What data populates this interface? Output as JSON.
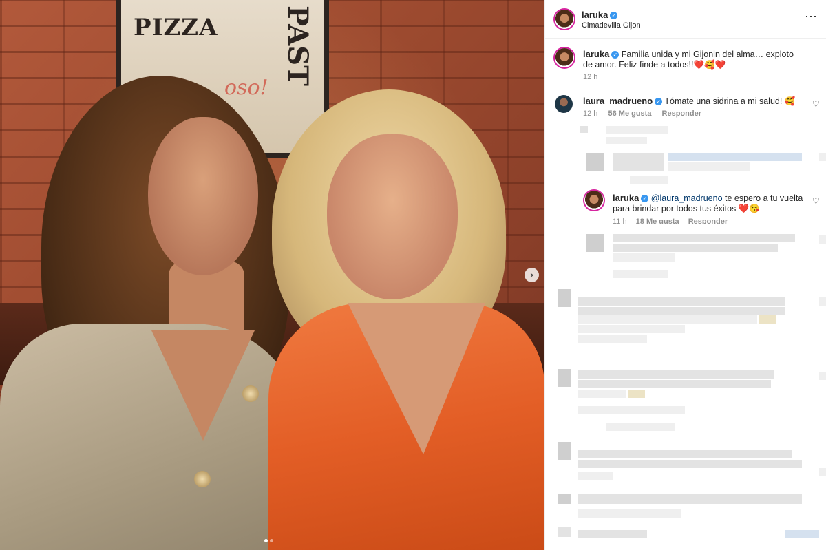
{
  "post": {
    "username": "laruka",
    "location": "Cimadevilla Gijon",
    "caption_user": "laruka",
    "caption_text": "Familia unida y mi Gijonin del alma… exploto de amor. Feliz finde a todos!!❤️🥰❤️",
    "caption_time": "12 h",
    "more_label": "⋯",
    "next_label": "›"
  },
  "photo": {
    "poster_left": "PIZZA",
    "poster_right": "PAST",
    "poster_script": "oso!"
  },
  "comments": [
    {
      "user": "laura_madrueno",
      "text": "Tómate una sidrina a mi salud! 🥰",
      "time": "12 h",
      "likes": "56 Me gusta",
      "reply_label": "Responder"
    }
  ],
  "reply": {
    "user": "laruka",
    "mention": "@laura_madrueno",
    "text": " te espero a tu vuelta para brindar por todos tus éxitos ❤️😘",
    "time": "11 h",
    "likes": "18 Me gusta",
    "reply_label": "Responder"
  },
  "icons": {
    "verified": "✓",
    "heart": "♡"
  },
  "colors": {
    "verified": "#3897f0",
    "meta_text": "#8e8e8e",
    "mention": "#00376b"
  }
}
